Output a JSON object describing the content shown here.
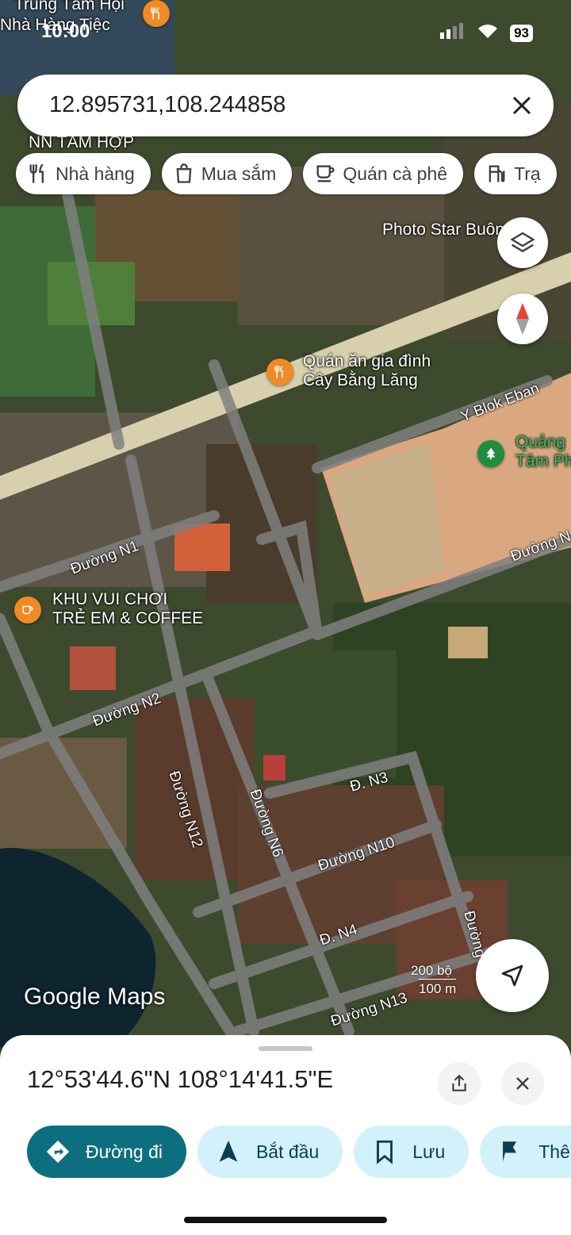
{
  "status_bar": {
    "time": "10:00",
    "battery": "93"
  },
  "search": {
    "query": "12.895731,108.244858"
  },
  "chips": [
    {
      "label": "Nhà hàng",
      "icon": "restaurant-icon"
    },
    {
      "label": "Mua sắm",
      "icon": "shopping-bag-icon"
    },
    {
      "label": "Quán cà phê",
      "icon": "coffee-icon"
    },
    {
      "label": "Trạ",
      "icon": "gas-station-icon"
    }
  ],
  "map": {
    "top_labels": {
      "a": "Trung Tâm Hội",
      "b": "Nhà Hàng Tiệc",
      "c": "NN TÂM HỢP"
    },
    "photo_star": "Photo Star Buôn",
    "restaurant_name": [
      "Quán ăn gia đình",
      "Cây Bằng Lăng"
    ],
    "park_name": [
      "Quảng",
      "Tâm Ph"
    ],
    "kids_cafe": [
      "KHU VUI CHƠI",
      "TRẺ EM & COFFEE"
    ],
    "roads": {
      "y_blok": "Y Blok Eban",
      "n1": "Đường N1",
      "n1_right": "Đường N",
      "n2": "Đường N2",
      "n3": "Đ. N3",
      "n4": "Đ. N4",
      "n6": "Đường N6",
      "n10": "Đường N10",
      "n12": "Đường N12",
      "n13": "Đường N13",
      "right_edge": "Đường"
    },
    "attribution": "Google Maps",
    "scale_ft": "200 bộ",
    "scale_m": "100 m"
  },
  "sheet": {
    "coords": "12°53'44.6\"N 108°14'41.5\"E",
    "actions": [
      {
        "label": "Đường đi"
      },
      {
        "label": "Bắt đầu"
      },
      {
        "label": "Lưu"
      },
      {
        "label": "Thê"
      }
    ]
  }
}
